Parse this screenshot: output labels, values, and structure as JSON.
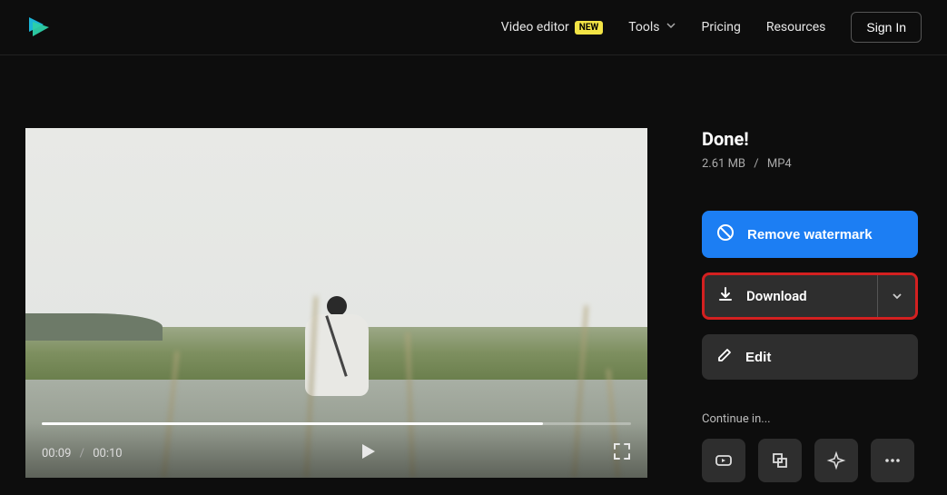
{
  "header": {
    "nav": {
      "video_editor": "Video editor",
      "video_editor_badge": "NEW",
      "tools": "Tools",
      "pricing": "Pricing",
      "resources": "Resources"
    },
    "signin": "Sign In"
  },
  "video": {
    "current_time": "00:09",
    "duration": "00:10",
    "separator": "/"
  },
  "sidebar": {
    "status": "Done!",
    "file_size": "2.61 MB",
    "file_format": "MP4",
    "separator": "/",
    "remove_watermark": "Remove watermark",
    "download": "Download",
    "edit": "Edit",
    "continue_in": "Continue in..."
  }
}
